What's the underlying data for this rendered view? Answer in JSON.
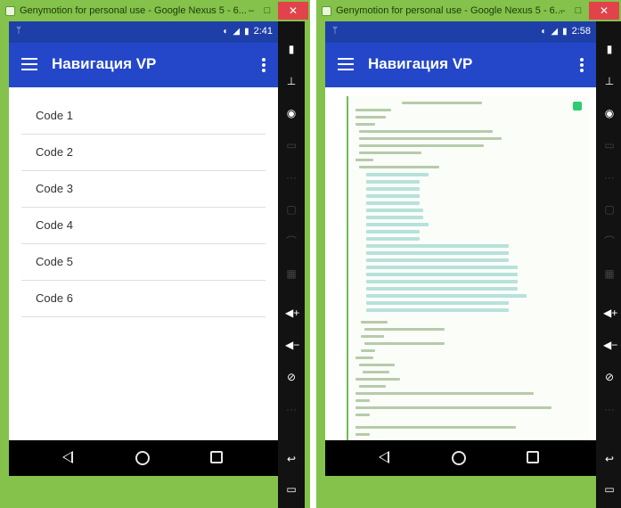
{
  "left_window": {
    "title": "Genymotion for personal use - Google Nexus 5 - 6...",
    "minimize": "–",
    "maximize": "□",
    "close": "✕",
    "status_time": "2:41",
    "app_title": "Навигация VP",
    "items": [
      {
        "label": "Code 1"
      },
      {
        "label": "Code 2"
      },
      {
        "label": "Code 3"
      },
      {
        "label": "Code 4"
      },
      {
        "label": "Code 5"
      },
      {
        "label": "Code 6"
      }
    ]
  },
  "right_window": {
    "title": "Genymotion for personal use - Google Nexus 5 - 6...",
    "minimize": "–",
    "maximize": "□",
    "close": "✕",
    "status_time": "2:58",
    "app_title": "Навигация VP"
  },
  "colors": {
    "window_frame": "#84c24b",
    "status_bar": "#1e3fa8",
    "app_bar": "#2447c9",
    "close_button": "#e2434a",
    "navigation_bar": "#000000"
  },
  "icons": {
    "status_left": "usb-icon",
    "status_right": [
      "alarm-icon",
      "signal-icon",
      "battery-icon"
    ],
    "sidebar": [
      "battery-icon",
      "gps-icon",
      "camera-icon",
      "sms-icon",
      "dots-icon",
      "id-icon",
      "rss-icon",
      "keyboard-icon",
      "volume-up-icon",
      "volume-down-icon",
      "rotate-icon",
      "dots-icon",
      "back-icon",
      "recent-icon"
    ]
  }
}
